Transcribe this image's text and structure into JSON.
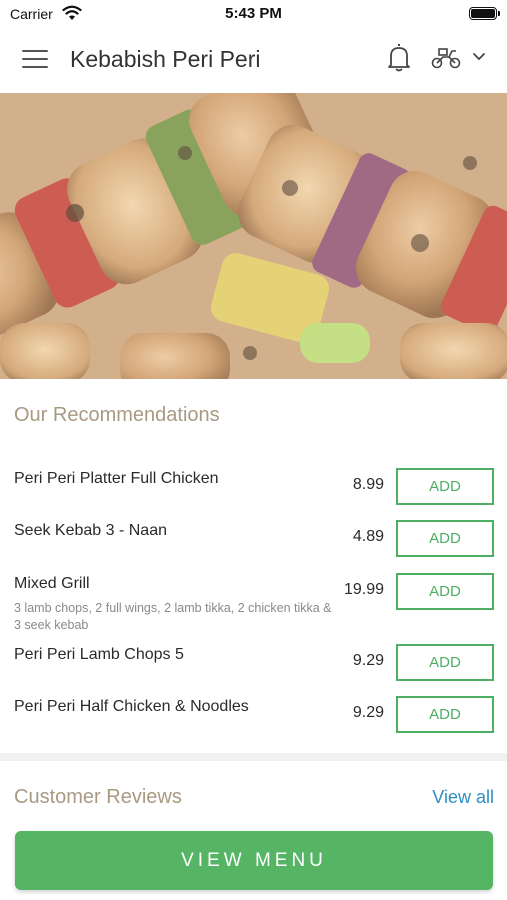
{
  "status_bar": {
    "carrier": "Carrier",
    "time": "5:43 PM"
  },
  "header": {
    "title": "Kebabish Peri Peri",
    "icons": [
      "menu-icon",
      "bell-icon",
      "scooter-icon",
      "chevron-down-icon"
    ]
  },
  "hero": {
    "image": "kebab-skewers-photo"
  },
  "recommendations": {
    "title": "Our Recommendations",
    "items": [
      {
        "name": "Peri Peri Platter Full Chicken",
        "description": "",
        "price": "8.99",
        "add_label": "ADD"
      },
      {
        "name": "Seek Kebab 3 - Naan",
        "description": "",
        "price": "4.89",
        "add_label": "ADD"
      },
      {
        "name": "Mixed Grill",
        "description": "3 lamb chops, 2 full wings, 2 lamb tikka, 2 chicken tikka & 3 seek kebab",
        "price": "19.99",
        "add_label": "ADD"
      },
      {
        "name": "Peri Peri Lamb Chops 5",
        "description": "",
        "price": "9.29",
        "add_label": "ADD"
      },
      {
        "name": "Peri Peri Half Chicken & Noodles",
        "description": "",
        "price": "9.29",
        "add_label": "ADD"
      }
    ]
  },
  "reviews": {
    "title": "Customer Reviews",
    "view_all_label": "View all"
  },
  "footer": {
    "view_menu_label": "VIEW MENU"
  },
  "colors": {
    "accent_green": "#4caf63",
    "button_green": "#56b465",
    "link_blue": "#2f8fc4",
    "section_title": "#a89a82"
  }
}
